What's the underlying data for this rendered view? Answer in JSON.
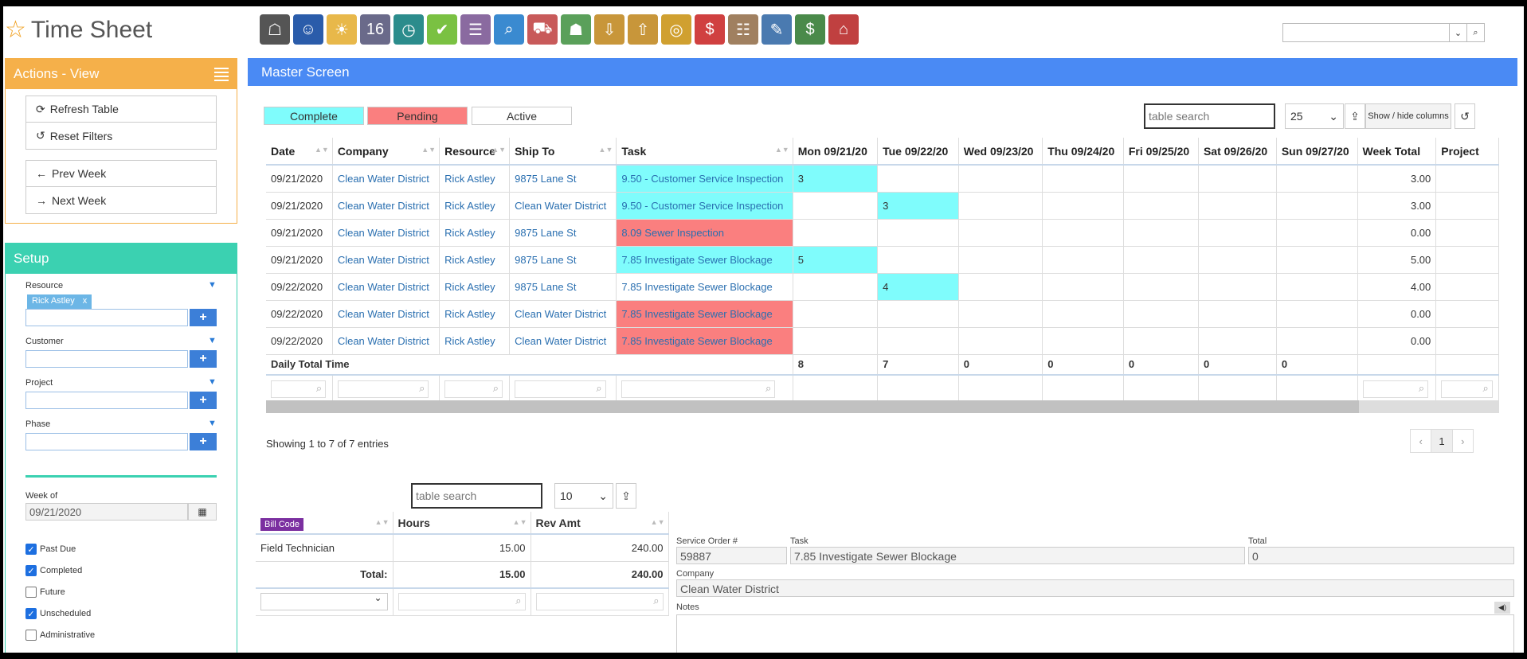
{
  "app": {
    "title": "Time Sheet",
    "toolbar_icons": [
      {
        "name": "bank-icon",
        "glyph": "☖",
        "color": "#555555"
      },
      {
        "name": "user-icon",
        "glyph": "☺",
        "color": "#2a5caa"
      },
      {
        "name": "weather-icon",
        "glyph": "☀",
        "color": "#e8b84a"
      },
      {
        "name": "calendar-16-icon",
        "glyph": "16",
        "color": "#6a6a8a"
      },
      {
        "name": "clock-icon",
        "glyph": "◷",
        "color": "#2b8c8c"
      },
      {
        "name": "checkmark-icon",
        "glyph": "✔",
        "color": "#7ac142"
      },
      {
        "name": "form-icon",
        "glyph": "☰",
        "color": "#8a6aa0"
      },
      {
        "name": "search-magnifier-icon",
        "glyph": "⌕",
        "color": "#3a8ad0"
      },
      {
        "name": "truck-icon",
        "glyph": "⛟",
        "color": "#c85a5a"
      },
      {
        "name": "basket-icon",
        "glyph": "☗",
        "color": "#5aa05a"
      },
      {
        "name": "download-box-icon",
        "glyph": "⇩",
        "color": "#c8963a"
      },
      {
        "name": "upload-box-icon",
        "glyph": "⇧",
        "color": "#c8963a"
      },
      {
        "name": "coins-icon",
        "glyph": "◎",
        "color": "#d0a030"
      },
      {
        "name": "dollar-speech-icon",
        "glyph": "$",
        "color": "#d04040"
      },
      {
        "name": "notepad-icon",
        "glyph": "☷",
        "color": "#a08060"
      },
      {
        "name": "pencil-icon",
        "glyph": "✎",
        "color": "#4a7ab0"
      },
      {
        "name": "money-icon",
        "glyph": "$",
        "color": "#4a8a4a"
      },
      {
        "name": "factory-icon",
        "glyph": "⌂",
        "color": "#c04040"
      }
    ],
    "global_search": {
      "placeholder": ""
    }
  },
  "actions": {
    "title": "Actions - View",
    "refresh_label": "Refresh Table",
    "reset_label": "Reset Filters",
    "prev_label": "Prev Week",
    "next_label": "Next Week"
  },
  "setup": {
    "title": "Setup",
    "resource_label": "Resource",
    "resource_chip": "Rick Astley",
    "customer_label": "Customer",
    "project_label": "Project",
    "phase_label": "Phase",
    "week_label": "Week of",
    "week_value": "09/21/2020",
    "checkboxes": [
      {
        "label": "Past Due",
        "checked": true
      },
      {
        "label": "Completed",
        "checked": true
      },
      {
        "label": "Future",
        "checked": false
      },
      {
        "label": "Unscheduled",
        "checked": true
      },
      {
        "label": "Administrative",
        "checked": false
      }
    ]
  },
  "master": {
    "title": "Master Screen",
    "legend": {
      "complete": "Complete",
      "pending": "Pending",
      "active": "Active"
    },
    "legend_colors": {
      "complete": "#7ffcfc",
      "pending": "#fa7f7f",
      "active": "#ffffff"
    },
    "search_placeholder": "table search",
    "page_size": "25",
    "show_hide_label": "Show / hide columns",
    "columns": [
      "Date",
      "Company",
      "Resource",
      "Ship To",
      "Task",
      "Mon 09/21/20",
      "Tue 09/22/20",
      "Wed 09/23/20",
      "Thu 09/24/20",
      "Fri 09/25/20",
      "Sat 09/26/20",
      "Sun 09/27/20",
      "Week Total",
      "Project"
    ],
    "rows": [
      {
        "date": "09/21/2020",
        "company": "Clean Water District",
        "resource": "Rick Astley",
        "ship_to": "9875 Lane St",
        "task": "9.50 - Customer Service Inspection",
        "task_status": "complete",
        "days": [
          "3",
          "",
          "",
          "",
          "",
          "",
          ""
        ],
        "day_status": [
          "complete",
          "",
          "",
          "",
          "",
          "",
          ""
        ],
        "total": "3.00"
      },
      {
        "date": "09/21/2020",
        "company": "Clean Water District",
        "resource": "Rick Astley",
        "ship_to": "Clean Water District",
        "task": "9.50 - Customer Service Inspection",
        "task_status": "complete",
        "days": [
          "",
          "3",
          "",
          "",
          "",
          "",
          ""
        ],
        "day_status": [
          "",
          "complete",
          "",
          "",
          "",
          "",
          ""
        ],
        "total": "3.00"
      },
      {
        "date": "09/21/2020",
        "company": "Clean Water District",
        "resource": "Rick Astley",
        "ship_to": "9875 Lane St",
        "task": "8.09 Sewer Inspection",
        "task_status": "pending",
        "days": [
          "",
          "",
          "",
          "",
          "",
          "",
          ""
        ],
        "day_status": [
          "",
          "",
          "",
          "",
          "",
          "",
          ""
        ],
        "total": "0.00"
      },
      {
        "date": "09/21/2020",
        "company": "Clean Water District",
        "resource": "Rick Astley",
        "ship_to": "9875 Lane St",
        "task": "7.85 Investigate Sewer Blockage",
        "task_status": "complete",
        "days": [
          "5",
          "",
          "",
          "",
          "",
          "",
          ""
        ],
        "day_status": [
          "complete",
          "",
          "",
          "",
          "",
          "",
          ""
        ],
        "total": "5.00"
      },
      {
        "date": "09/22/2020",
        "company": "Clean Water District",
        "resource": "Rick Astley",
        "ship_to": "9875 Lane St",
        "task": "7.85 Investigate Sewer Blockage",
        "task_status": "active",
        "days": [
          "",
          "4",
          "",
          "",
          "",
          "",
          ""
        ],
        "day_status": [
          "",
          "complete",
          "",
          "",
          "",
          "",
          ""
        ],
        "total": "4.00"
      },
      {
        "date": "09/22/2020",
        "company": "Clean Water District",
        "resource": "Rick Astley",
        "ship_to": "Clean Water District",
        "task": "7.85 Investigate Sewer Blockage",
        "task_status": "pending",
        "days": [
          "",
          "",
          "",
          "",
          "",
          "",
          ""
        ],
        "day_status": [
          "",
          "",
          "",
          "",
          "",
          "",
          ""
        ],
        "total": "0.00"
      },
      {
        "date": "09/22/2020",
        "company": "Clean Water District",
        "resource": "Rick Astley",
        "ship_to": "Clean Water District",
        "task": "7.85 Investigate Sewer Blockage",
        "task_status": "pending",
        "days": [
          "",
          "",
          "",
          "",
          "",
          "",
          ""
        ],
        "day_status": [
          "",
          "",
          "",
          "",
          "",
          "",
          ""
        ],
        "total": "0.00"
      }
    ],
    "daily_total_label": "Daily Total Time",
    "daily_totals": [
      "8",
      "7",
      "0",
      "0",
      "0",
      "0",
      "0"
    ],
    "entries_text": "Showing 1 to 7 of 7 entries",
    "pager": {
      "prev": "‹",
      "current": "1",
      "next": "›"
    }
  },
  "detail": {
    "search_placeholder": "table search",
    "page_size": "10",
    "columns": [
      "Bill Code",
      "Hours",
      "Rev Amt"
    ],
    "rows": [
      {
        "bill_code": "Field Technician",
        "hours": "15.00",
        "rev_amt": "240.00"
      }
    ],
    "total_label": "Total:",
    "total_hours": "15.00",
    "total_rev": "240.00",
    "service_order_label": "Service Order #",
    "service_order_value": "59887",
    "task_label": "Task",
    "task_value": "7.85 Investigate Sewer Blockage",
    "total_field_label": "Total",
    "total_field_value": "0",
    "company_label": "Company",
    "company_value": "Clean Water District",
    "notes_label": "Notes"
  }
}
